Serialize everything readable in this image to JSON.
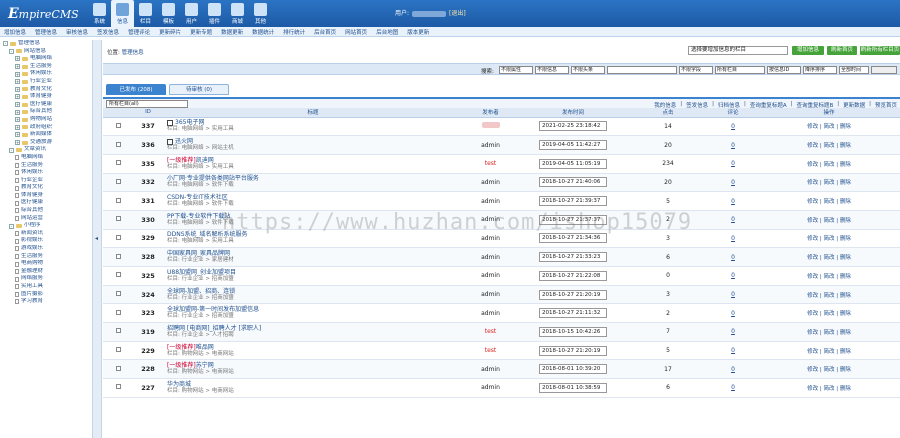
{
  "app": {
    "logo_main": "E",
    "logo_rest": "mpireCMS"
  },
  "topnav": [
    {
      "label": "系统",
      "icon": "system-icon"
    },
    {
      "label": "信息",
      "icon": "info-icon"
    },
    {
      "label": "栏目",
      "icon": "column-icon"
    },
    {
      "label": "模板",
      "icon": "template-icon"
    },
    {
      "label": "用户",
      "icon": "user-icon"
    },
    {
      "label": "插件",
      "icon": "plugin-icon"
    },
    {
      "label": "商城",
      "icon": "shop-icon"
    },
    {
      "label": "其他",
      "icon": "other-icon"
    }
  ],
  "user": {
    "prefix": "用户:",
    "logout": "[退出]"
  },
  "subnav": [
    "增加信息",
    "管理信息",
    "审核信息",
    "签发信息",
    "管理评论",
    "更新碎片",
    "更新专题",
    "数据更新",
    "数据统计",
    "排行统计",
    "后台首页",
    "网站首页",
    "后台地图",
    "版本更新"
  ],
  "sidebar": [
    {
      "depth": 0,
      "type": "root",
      "label": "管理信息"
    },
    {
      "depth": 1,
      "type": "folder",
      "label": "网站信息"
    },
    {
      "depth": 2,
      "type": "folder",
      "label": "电脑网络"
    },
    {
      "depth": 2,
      "type": "folder",
      "label": "生活服务"
    },
    {
      "depth": 2,
      "type": "folder",
      "label": "休闲娱乐"
    },
    {
      "depth": 2,
      "type": "folder",
      "label": "行业企业"
    },
    {
      "depth": 2,
      "type": "folder",
      "label": "教育文化"
    },
    {
      "depth": 2,
      "type": "folder",
      "label": "体育健身"
    },
    {
      "depth": 2,
      "type": "folder",
      "label": "医疗健康"
    },
    {
      "depth": 2,
      "type": "folder",
      "label": "综合其他"
    },
    {
      "depth": 2,
      "type": "folder",
      "label": "购物网站"
    },
    {
      "depth": 2,
      "type": "folder",
      "label": "政府组织"
    },
    {
      "depth": 2,
      "type": "folder",
      "label": "新闻媒体"
    },
    {
      "depth": 2,
      "type": "folder",
      "label": "交通旅游"
    },
    {
      "depth": 1,
      "type": "folder",
      "label": "文章资讯"
    },
    {
      "depth": 2,
      "type": "page",
      "label": "电脑网络"
    },
    {
      "depth": 2,
      "type": "page",
      "label": "生活服务"
    },
    {
      "depth": 2,
      "type": "page",
      "label": "休闲娱乐"
    },
    {
      "depth": 2,
      "type": "page",
      "label": "行业企业"
    },
    {
      "depth": 2,
      "type": "page",
      "label": "教育文化"
    },
    {
      "depth": 2,
      "type": "page",
      "label": "体育健身"
    },
    {
      "depth": 2,
      "type": "page",
      "label": "医疗健康"
    },
    {
      "depth": 2,
      "type": "page",
      "label": "综合其他"
    },
    {
      "depth": 2,
      "type": "page",
      "label": "网站运营"
    },
    {
      "depth": 1,
      "type": "folder",
      "label": "小程序"
    },
    {
      "depth": 2,
      "type": "page",
      "label": "新闻资讯"
    },
    {
      "depth": 2,
      "type": "page",
      "label": "影视娱乐"
    },
    {
      "depth": 2,
      "type": "page",
      "label": "游戏娱乐"
    },
    {
      "depth": 2,
      "type": "page",
      "label": "生活服务"
    },
    {
      "depth": 2,
      "type": "page",
      "label": "电商购物"
    },
    {
      "depth": 2,
      "type": "page",
      "label": "金融理财"
    },
    {
      "depth": 2,
      "type": "page",
      "label": "网络服务"
    },
    {
      "depth": 2,
      "type": "page",
      "label": "实用工具"
    },
    {
      "depth": 2,
      "type": "page",
      "label": "图片摄影"
    },
    {
      "depth": 2,
      "type": "page",
      "label": "学习教育"
    }
  ],
  "breadcrumb": {
    "prefix": "位置:",
    "link": "管理信息"
  },
  "quick": {
    "select": "选择要增加信息的栏目",
    "btn_add": "增加信息",
    "btn_home": "刷新首页",
    "btn_all": "刷新所有栏目页"
  },
  "search": {
    "label": "搜索:",
    "s1": "不限属性",
    "s2": "不限信息",
    "s3": "不限头条",
    "s4": "不限字段",
    "s5": "所有栏目",
    "s6": "按信息ID",
    "s7": "降序排序",
    "s8": "全部时间"
  },
  "tabs": {
    "published": "已发布 (208)",
    "pending": "待审核 (0)"
  },
  "filter": {
    "column": "所有栏目(all)",
    "links": [
      "我的信息",
      "签发信息",
      "归档信息",
      "查询重复标题A",
      "查询重复标题B",
      "更新数据",
      "预览首页"
    ]
  },
  "table": {
    "headers": [
      "",
      "ID",
      "标题",
      "发布者",
      "发布时间",
      "点击",
      "评论",
      "操作"
    ],
    "ops": "修改 | 简改 | 删除",
    "rows": [
      {
        "id": "337",
        "pic": true,
        "tag": "",
        "title": "365电子网",
        "col": "栏目: 电脑网络 > 实用工具",
        "pub": "",
        "pub_style": "blur",
        "time": "2021-02-25 23:18:42",
        "hits": "14",
        "cm": "0"
      },
      {
        "id": "336",
        "pic": true,
        "tag": "",
        "title": "迅火网",
        "col": "栏目: 电脑网络 > 网站主机",
        "pub": "admin",
        "pub_style": "",
        "time": "2019-04-05 11:42:27",
        "hits": "20",
        "cm": "0"
      },
      {
        "id": "335",
        "pic": false,
        "tag": "[一级推荐]",
        "title": "凯迪网",
        "col": "栏目: 电脑网络 > 实用工具",
        "pub": "test",
        "pub_style": "red",
        "time": "2019-04-05 11:05:19",
        "hits": "234",
        "cm": "0"
      },
      {
        "id": "332",
        "pic": false,
        "tag": "",
        "title": "小厂网·专业提供各类网站平台服务",
        "col": "栏目: 电脑网络 > 软件下载",
        "pub": "admin",
        "pub_style": "",
        "time": "2018-10-27 21:40:06",
        "hits": "20",
        "cm": "0"
      },
      {
        "id": "331",
        "pic": false,
        "tag": "",
        "title": "CSDN-专业IT技术社区",
        "col": "栏目: 电脑网络 > 软件下载",
        "pub": "admin",
        "pub_style": "",
        "time": "2018-10-27 21:39:37",
        "hits": "5",
        "cm": "0"
      },
      {
        "id": "330",
        "pic": false,
        "tag": "",
        "title": "PP下载-专业软件下载站",
        "col": "栏目: 电脑网络 > 软件下载",
        "pub": "admin",
        "pub_style": "",
        "time": "2018-10-27 21:37:37",
        "hits": "2",
        "cm": "0"
      },
      {
        "id": "329",
        "pic": false,
        "tag": "",
        "title": "DDNS系统_域名解析系统服务",
        "col": "栏目: 电脑网络 > 实用工具",
        "pub": "admin",
        "pub_style": "",
        "time": "2018-10-27 21:34:36",
        "hits": "3",
        "cm": "0"
      },
      {
        "id": "328",
        "pic": false,
        "tag": "",
        "title": "中国家具网_家具品牌网",
        "col": "栏目: 行业企业 > 家居建材",
        "pub": "admin",
        "pub_style": "",
        "time": "2018-10-27 21:33:23",
        "hits": "6",
        "cm": "0"
      },
      {
        "id": "325",
        "pic": false,
        "tag": "",
        "title": "U88加盟网_创业加盟项目",
        "col": "栏目: 行业企业 > 招商加盟",
        "pub": "admin",
        "pub_style": "",
        "time": "2018-10-27 21:22:08",
        "hits": "0",
        "cm": "0"
      },
      {
        "id": "324",
        "pic": false,
        "tag": "",
        "title": "全球网-加盟、招商、连锁",
        "col": "栏目: 行业企业 > 招商加盟",
        "pub": "admin",
        "pub_style": "",
        "time": "2018-10-27 21:20:19",
        "hits": "3",
        "cm": "0"
      },
      {
        "id": "323",
        "pic": false,
        "tag": "",
        "title": "全球加盟网-第一时间发布加盟信息",
        "col": "栏目: 行业企业 > 招商加盟",
        "pub": "admin",
        "pub_style": "",
        "time": "2018-10-27 21:11:32",
        "hits": "2",
        "cm": "0"
      },
      {
        "id": "319",
        "pic": false,
        "tag": "",
        "title": "招聘网 [电商网]_招聘人才 [求职人]",
        "col": "栏目: 行业企业 > 人才招聘",
        "pub": "test",
        "pub_style": "red",
        "time": "2018-10-15 10:42:26",
        "hits": "7",
        "cm": "0"
      },
      {
        "id": "229",
        "pic": false,
        "tag": "[一级推荐]",
        "title": "唯品网",
        "col": "栏目: 购物网站 > 电商网站",
        "pub": "test",
        "pub_style": "red",
        "time": "2018-10-27 21:20:19",
        "hits": "5",
        "cm": "0"
      },
      {
        "id": "228",
        "pic": false,
        "tag": "[一级推荐]",
        "title": "苏宁网",
        "col": "栏目: 购物网站 > 电商网站",
        "pub": "admin",
        "pub_style": "",
        "time": "2018-08-01 10:39:20",
        "hits": "17",
        "cm": "0"
      },
      {
        "id": "227",
        "pic": false,
        "tag": "",
        "title": "华为商城",
        "col": "栏目: 购物网站 > 电商网站",
        "pub": "admin",
        "pub_style": "",
        "time": "2018-08-01 10:38:59",
        "hits": "6",
        "cm": "0"
      }
    ]
  },
  "watermark": "https://www.huzhan.com/ishop15079"
}
